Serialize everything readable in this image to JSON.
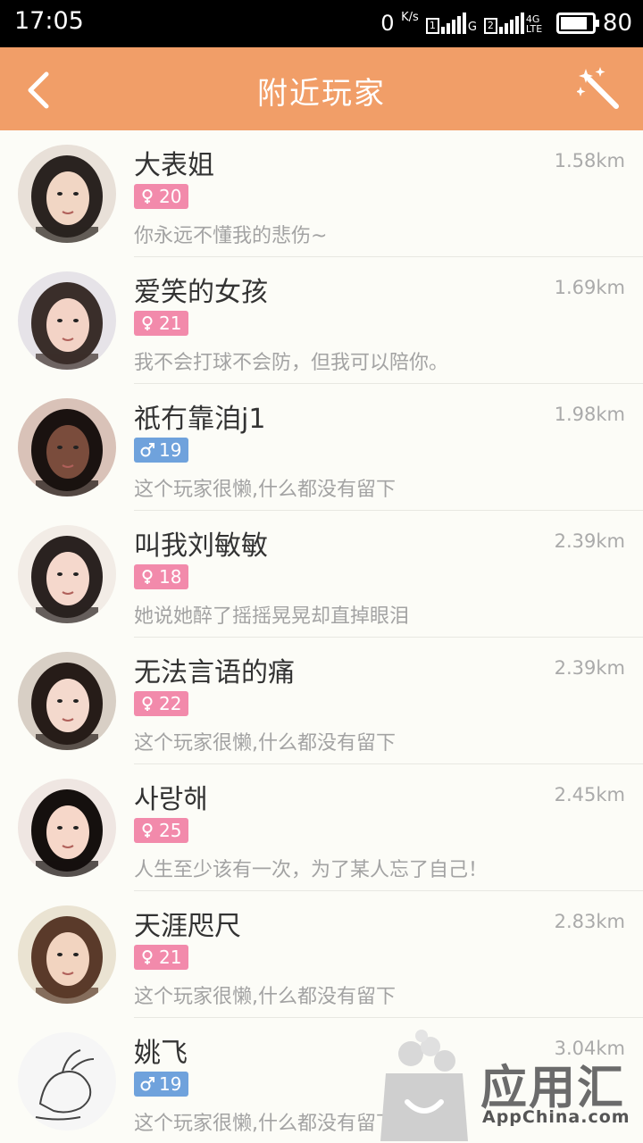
{
  "status_bar": {
    "time": "17:05",
    "speed_value": "0",
    "speed_unit": "K/s",
    "sim1": "1",
    "sim1_type": "G",
    "sim2": "2",
    "sim2_type": "4G LTE",
    "battery": "80",
    "battery_level": 0.8
  },
  "header": {
    "title": "附近玩家",
    "back_icon": "chevron-left-icon",
    "action_icon": "magic-wand-icon"
  },
  "players": [
    {
      "name": "大表姐",
      "gender": "female",
      "age": "20",
      "distance": "1.58km",
      "signature": "你永远不懂我的悲伤~"
    },
    {
      "name": "爱笑的女孩",
      "gender": "female",
      "age": "21",
      "distance": "1.69km",
      "signature": "我不会打球不会防，但我可以陪你。"
    },
    {
      "name": "祇冇靠洎j1",
      "gender": "male",
      "age": "19",
      "distance": "1.98km",
      "signature": "这个玩家很懒,什么都没有留下"
    },
    {
      "name": "叫我刘敏敏",
      "gender": "female",
      "age": "18",
      "distance": "2.39km",
      "signature": "她说她醉了摇摇晃晃却直掉眼泪"
    },
    {
      "name": "无法言语的痛",
      "gender": "female",
      "age": "22",
      "distance": "2.39km",
      "signature": "这个玩家很懒,什么都没有留下"
    },
    {
      "name": "사랑해",
      "gender": "female",
      "age": "25",
      "distance": "2.45km",
      "signature": "人生至少该有一次，为了某人忘了自己！"
    },
    {
      "name": "天涯咫尺",
      "gender": "female",
      "age": "21",
      "distance": "2.83km",
      "signature": "这个玩家很懒,什么都没有留下"
    },
    {
      "name": "姚飞",
      "gender": "male",
      "age": "19",
      "distance": "3.04km",
      "signature": "这个玩家很懒,什么都没有留下"
    }
  ],
  "watermark": {
    "text": "应用汇",
    "sub": "AppChina.com"
  },
  "colors": {
    "header": "#f19e68",
    "female": "#f28aab",
    "male": "#6fa2dc"
  }
}
